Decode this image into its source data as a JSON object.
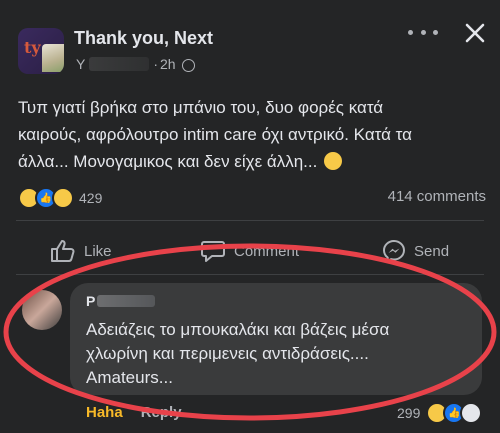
{
  "post": {
    "group_name": "Thank you, Next",
    "author_prefix": "Υ",
    "time_sep": "·",
    "time": "2h",
    "text_line1": "Τυπ γιατί βρήκα στο μπάνιο του, δυο φορές κατά",
    "text_line2": "καιρούς, αφρόλουτρο intim care όχι αντρικό. Κατά τα",
    "text_line3": "άλλα... Μονογαμικος και δεν είχε άλλη..."
  },
  "reactions": {
    "count": "429",
    "types": [
      "haha",
      "like",
      "sad"
    ],
    "comments_label": "414 comments"
  },
  "actions": {
    "like": "Like",
    "comment": "Comment",
    "send": "Send"
  },
  "comment": {
    "author_prefix": "P",
    "text_line1": "Αδειάζεις το μπουκαλάκι και βάζεις μέσα",
    "text_line2": "χλωρίνη και περιμενεις αντιδράσεις....",
    "text_line3": "Amateurs...",
    "haha_label": "Haha",
    "reply_label": "Reply",
    "reaction_count": "299"
  },
  "colors": {
    "background": "#242526",
    "bubble": "#3a3b3c",
    "text": "#e4e6eb",
    "muted": "#b0b3b8",
    "haha": "#f7b928",
    "like_blue": "#1877f2",
    "annotation": "#e8424a"
  }
}
